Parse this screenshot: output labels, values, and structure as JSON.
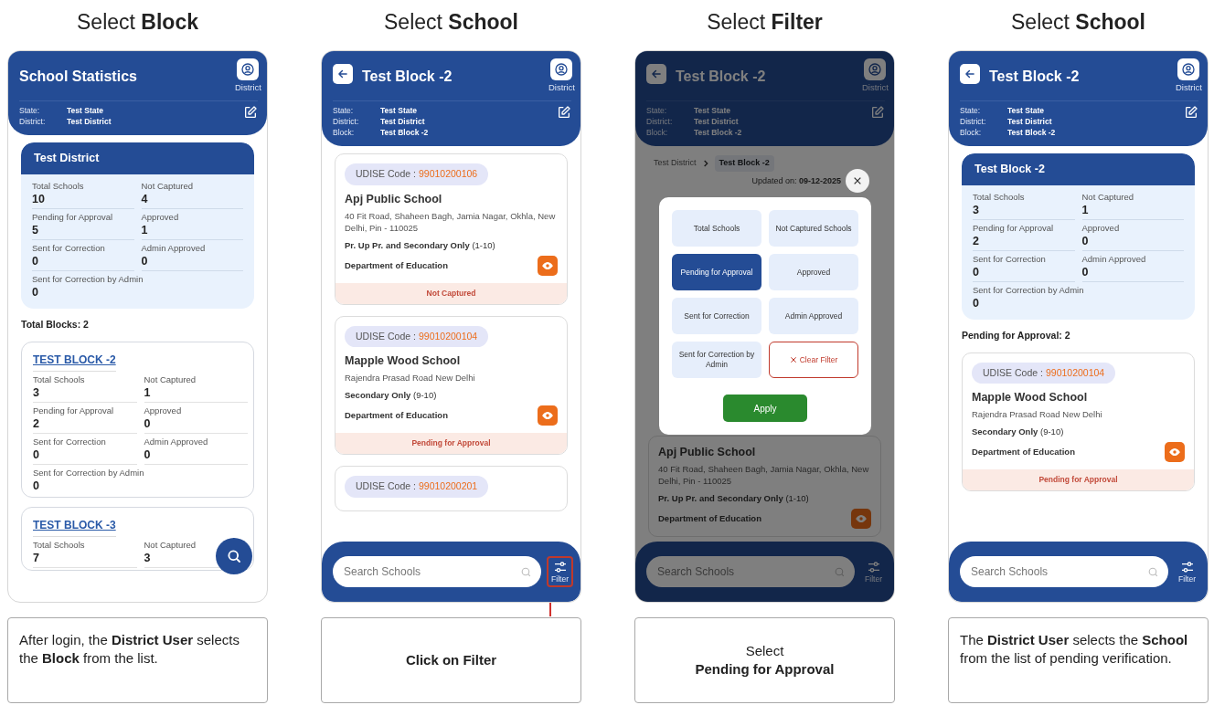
{
  "panels": [
    {
      "heading": "Select **Block**",
      "caption": [
        {
          "text": "After login, the **District User** selects the **Block** from the list.",
          "bold": false
        }
      ],
      "screen": {
        "header": {
          "back": false,
          "title": "School Statistics",
          "profile_label": "District",
          "info": [
            {
              "label": "State:",
              "value": "Test State"
            },
            {
              "label": "District:",
              "value": "Test District"
            }
          ]
        },
        "body": [
          {
            "kind": "stats_card",
            "title": "Test District",
            "stats": [
              {
                "label": "Total Schools",
                "value": "10"
              },
              {
                "label": "Not Captured",
                "value": "4"
              },
              {
                "label": "Pending for Approval",
                "value": "5"
              },
              {
                "label": "Approved",
                "value": "1"
              },
              {
                "label": "Sent for Correction",
                "value": "0"
              },
              {
                "label": "Admin Approved",
                "value": "0"
              },
              {
                "label": "Sent for Correction by Admin",
                "value": "0"
              }
            ]
          },
          {
            "kind": "count",
            "text": "Total Blocks: 2"
          },
          {
            "kind": "block_card",
            "title": "TEST BLOCK -2",
            "stats": [
              {
                "label": "Total Schools",
                "value": "3"
              },
              {
                "label": "Not Captured",
                "value": "1"
              },
              {
                "label": "Pending for Approval",
                "value": "2"
              },
              {
                "label": "Approved",
                "value": "0"
              },
              {
                "label": "Sent for Correction",
                "value": "0"
              },
              {
                "label": "Admin Approved",
                "value": "0"
              },
              {
                "label": "Sent for Correction by Admin",
                "value": "0"
              }
            ]
          },
          {
            "kind": "block_card",
            "title": "TEST BLOCK -3",
            "stats": [
              {
                "label": "Total Schools",
                "value": "7"
              },
              {
                "label": "Not Captured",
                "value": "3"
              }
            ]
          }
        ],
        "search_fab": true
      }
    },
    {
      "heading": "Select **School**",
      "caption": [
        {
          "text": "Click on Filter",
          "bold": true
        }
      ],
      "screen": {
        "header": {
          "back": true,
          "title": "Test Block -2",
          "profile_label": "District",
          "info": [
            {
              "label": "State:",
              "value": "Test State"
            },
            {
              "label": "District:",
              "value": "Test District"
            },
            {
              "label": "Block:",
              "value": "Test Block -2"
            }
          ]
        },
        "body": [
          {
            "kind": "school_card",
            "udise_label": "UDISE Code :",
            "udise_code": "99010200106",
            "name": "Apj Public School",
            "address": "40 Fit Road, Shaheen Bagh, Jamia Nagar, Okhla, New Delhi, Pin - 110025",
            "level": "**Pr. Up Pr. and Secondary Only** (1-10)",
            "department": "Department of Education",
            "status": "Not Captured"
          },
          {
            "kind": "school_card",
            "udise_label": "UDISE Code :",
            "udise_code": "99010200104",
            "name": "Mapple Wood School",
            "address": "Rajendra Prasad Road New Delhi",
            "level": "**Secondary Only** (9-10)",
            "department": "Department of Education",
            "status": "Pending for Approval"
          },
          {
            "kind": "school_card",
            "udise_label": "UDISE Code :",
            "udise_code": "99010200201"
          }
        ],
        "bottom": {
          "placeholder": "Search Schools",
          "filter_label": "Filter",
          "filter_highlighted": true
        }
      }
    },
    {
      "heading": "Select **Filter**",
      "caption": [
        {
          "text": "Select",
          "bold": false
        },
        {
          "text": "Pending for Approval",
          "bold": true
        }
      ],
      "screen": {
        "header": {
          "back": true,
          "title": "Test Block -2",
          "profile_label": "District",
          "info": [
            {
              "label": "State:",
              "value": "Test State"
            },
            {
              "label": "District:",
              "value": "Test District"
            },
            {
              "label": "Block:",
              "value": "Test Block -2"
            }
          ]
        },
        "body": [
          {
            "kind": "breadcrumb",
            "items": [
              "Test District",
              "Test Block -2"
            ]
          },
          {
            "kind": "updated",
            "text": "Updated on: **09-12-2025**"
          },
          {
            "kind": "school_card",
            "name": "Apj Public School",
            "address": "40 Fit Road, Shaheen Bagh, Jamia Nagar, Okhla, New Delhi, Pin - 110025",
            "level": "**Pr. Up Pr. and Secondary Only** (1-10)",
            "department": "Department of Education"
          }
        ],
        "bottom": {
          "placeholder": "Search Schools",
          "filter_label": "Filter",
          "filter_highlighted": false
        },
        "modal": {
          "options": [
            {
              "kind": "option",
              "label": "Total Schools",
              "selected": false
            },
            {
              "kind": "option",
              "label": "Not Captured Schools",
              "selected": false
            },
            {
              "kind": "option",
              "label": "Pending for Approval",
              "selected": true
            },
            {
              "kind": "option",
              "label": "Approved",
              "selected": false
            },
            {
              "kind": "option",
              "label": "Sent for Correction",
              "selected": false
            },
            {
              "kind": "option",
              "label": "Admin Approved",
              "selected": false
            },
            {
              "kind": "option",
              "label": "Sent for Correction by Admin",
              "selected": false
            },
            {
              "kind": "clear",
              "label": "Clear Filter"
            }
          ],
          "apply_label": "Apply"
        }
      }
    },
    {
      "heading": "Select **School**",
      "caption": [
        {
          "text": "The **District User** selects the **School** from the list of pending verification.",
          "bold": false
        }
      ],
      "screen": {
        "header": {
          "back": true,
          "title": "Test Block -2",
          "profile_label": "District",
          "info": [
            {
              "label": "State:",
              "value": "Test State"
            },
            {
              "label": "District:",
              "value": "Test District"
            },
            {
              "label": "Block:",
              "value": "Test Block -2"
            }
          ]
        },
        "body": [
          {
            "kind": "stats_card",
            "title": "Test Block -2",
            "stats": [
              {
                "label": "Total Schools",
                "value": "3"
              },
              {
                "label": "Not Captured",
                "value": "1"
              },
              {
                "label": "Pending for Approval",
                "value": "2"
              },
              {
                "label": "Approved",
                "value": "0"
              },
              {
                "label": "Sent for Correction",
                "value": "0"
              },
              {
                "label": "Admin Approved",
                "value": "0"
              },
              {
                "label": "Sent for Correction by Admin",
                "value": "0"
              }
            ]
          },
          {
            "kind": "count",
            "text": "Pending for Approval: 2"
          },
          {
            "kind": "school_card",
            "udise_label": "UDISE Code :",
            "udise_code": "99010200104",
            "name": "Mapple Wood School",
            "address": "Rajendra Prasad Road New Delhi",
            "level": "**Secondary Only** (9-10)",
            "department": "Department of Education",
            "status": "Pending for Approval"
          }
        ],
        "bottom": {
          "placeholder": "Search Schools",
          "filter_label": "Filter",
          "filter_highlighted": false
        }
      }
    }
  ]
}
